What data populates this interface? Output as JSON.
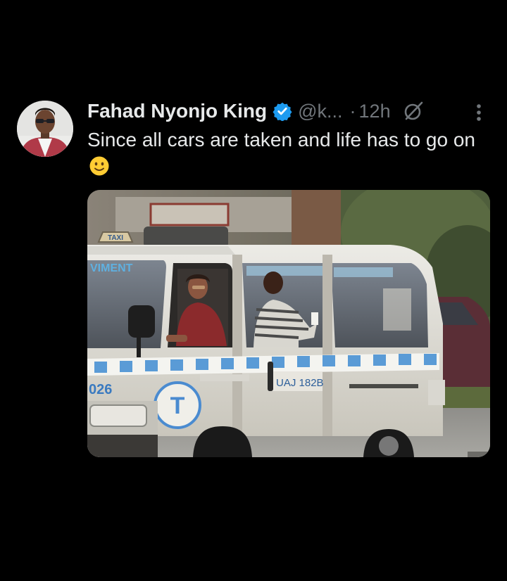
{
  "tweet": {
    "author": {
      "display_name": "Fahad Nyonjo King",
      "handle": "@k...",
      "verified": true,
      "avatar_icon": "profile-photo"
    },
    "separator": "·",
    "timestamp": "12h",
    "text": "Since all cars are taken and life has to go on",
    "emoji": "slightly-smiling-face",
    "media": {
      "type": "photo",
      "plate_text": "UAJ 182B",
      "side_text": "026",
      "windshield_text": "VIMENT",
      "roof_sign_text": "TAXI",
      "door_logo": "T"
    }
  },
  "colors": {
    "background": "#000000",
    "primary_text": "#e7e9ea",
    "secondary_text": "#71767b",
    "verified_blue": "#1d9bf0"
  },
  "icons": {
    "verified": "verified-badge-icon",
    "grok": "grok-icon",
    "more": "more-options-icon"
  }
}
